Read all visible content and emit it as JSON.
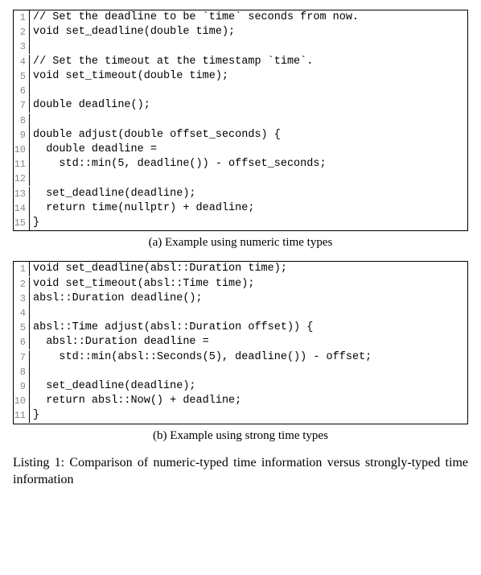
{
  "codeA": {
    "lines": [
      "// Set the deadline to be `time` seconds from now.",
      "void set_deadline(double time);",
      "",
      "// Set the timeout at the timestamp `time`.",
      "void set_timeout(double time);",
      "",
      "double deadline();",
      "",
      "double adjust(double offset_seconds) {",
      "  double deadline =",
      "    std::min(5, deadline()) - offset_seconds;",
      "",
      "  set_deadline(deadline);",
      "  return time(nullptr) + deadline;",
      "}"
    ]
  },
  "captionA": "(a) Example using numeric time types",
  "codeB": {
    "lines": [
      "void set_deadline(absl::Duration time);",
      "void set_timeout(absl::Time time);",
      "absl::Duration deadline();",
      "",
      "absl::Time adjust(absl::Duration offset)) {",
      "  absl::Duration deadline =",
      "    std::min(absl::Seconds(5), deadline()) - offset;",
      "",
      "  set_deadline(deadline);",
      "  return absl::Now() + deadline;",
      "}"
    ]
  },
  "captionB": "(b) Example using strong time types",
  "listingCaption": "Listing 1: Comparison of numeric-typed time information versus strongly-typed time information"
}
